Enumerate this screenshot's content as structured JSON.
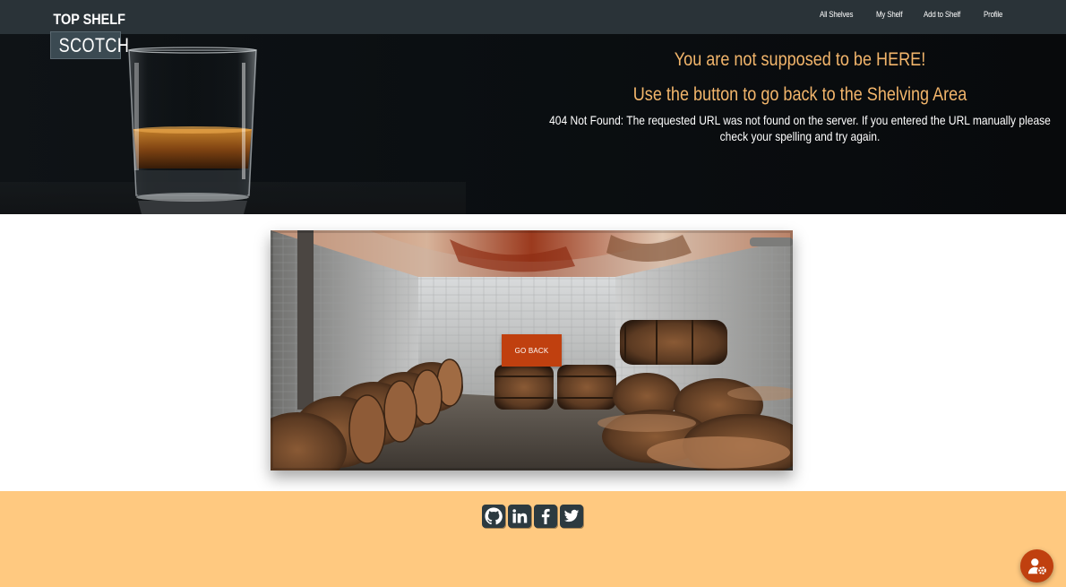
{
  "brand": {
    "line1": "TOP SHELF",
    "line2": "SCOTCH"
  },
  "nav": {
    "items": [
      {
        "label": "All Shelves"
      },
      {
        "label": "My Shelf"
      },
      {
        "label": "Add to Shelf"
      },
      {
        "label": "Profile"
      }
    ]
  },
  "hero": {
    "title": "You are not supposed to be HERE!",
    "subtitle": "Use the button to go back to the Shelving Area",
    "message": "404 Not Found: The requested URL was not found on the server. If you entered the URL manually please check your spelling and try again."
  },
  "card": {
    "button_label": "GO BACK"
  },
  "footer": {
    "social": [
      {
        "icon": "github-icon"
      },
      {
        "icon": "linkedin-icon"
      },
      {
        "icon": "facebook-icon"
      },
      {
        "icon": "twitter-icon"
      }
    ]
  },
  "fab": {
    "icon": "user-settings-icon"
  },
  "colors": {
    "navbar": "#2a3338",
    "accent": "#c0400f",
    "heading": "#f2b56b",
    "footer": "#ffc980"
  }
}
